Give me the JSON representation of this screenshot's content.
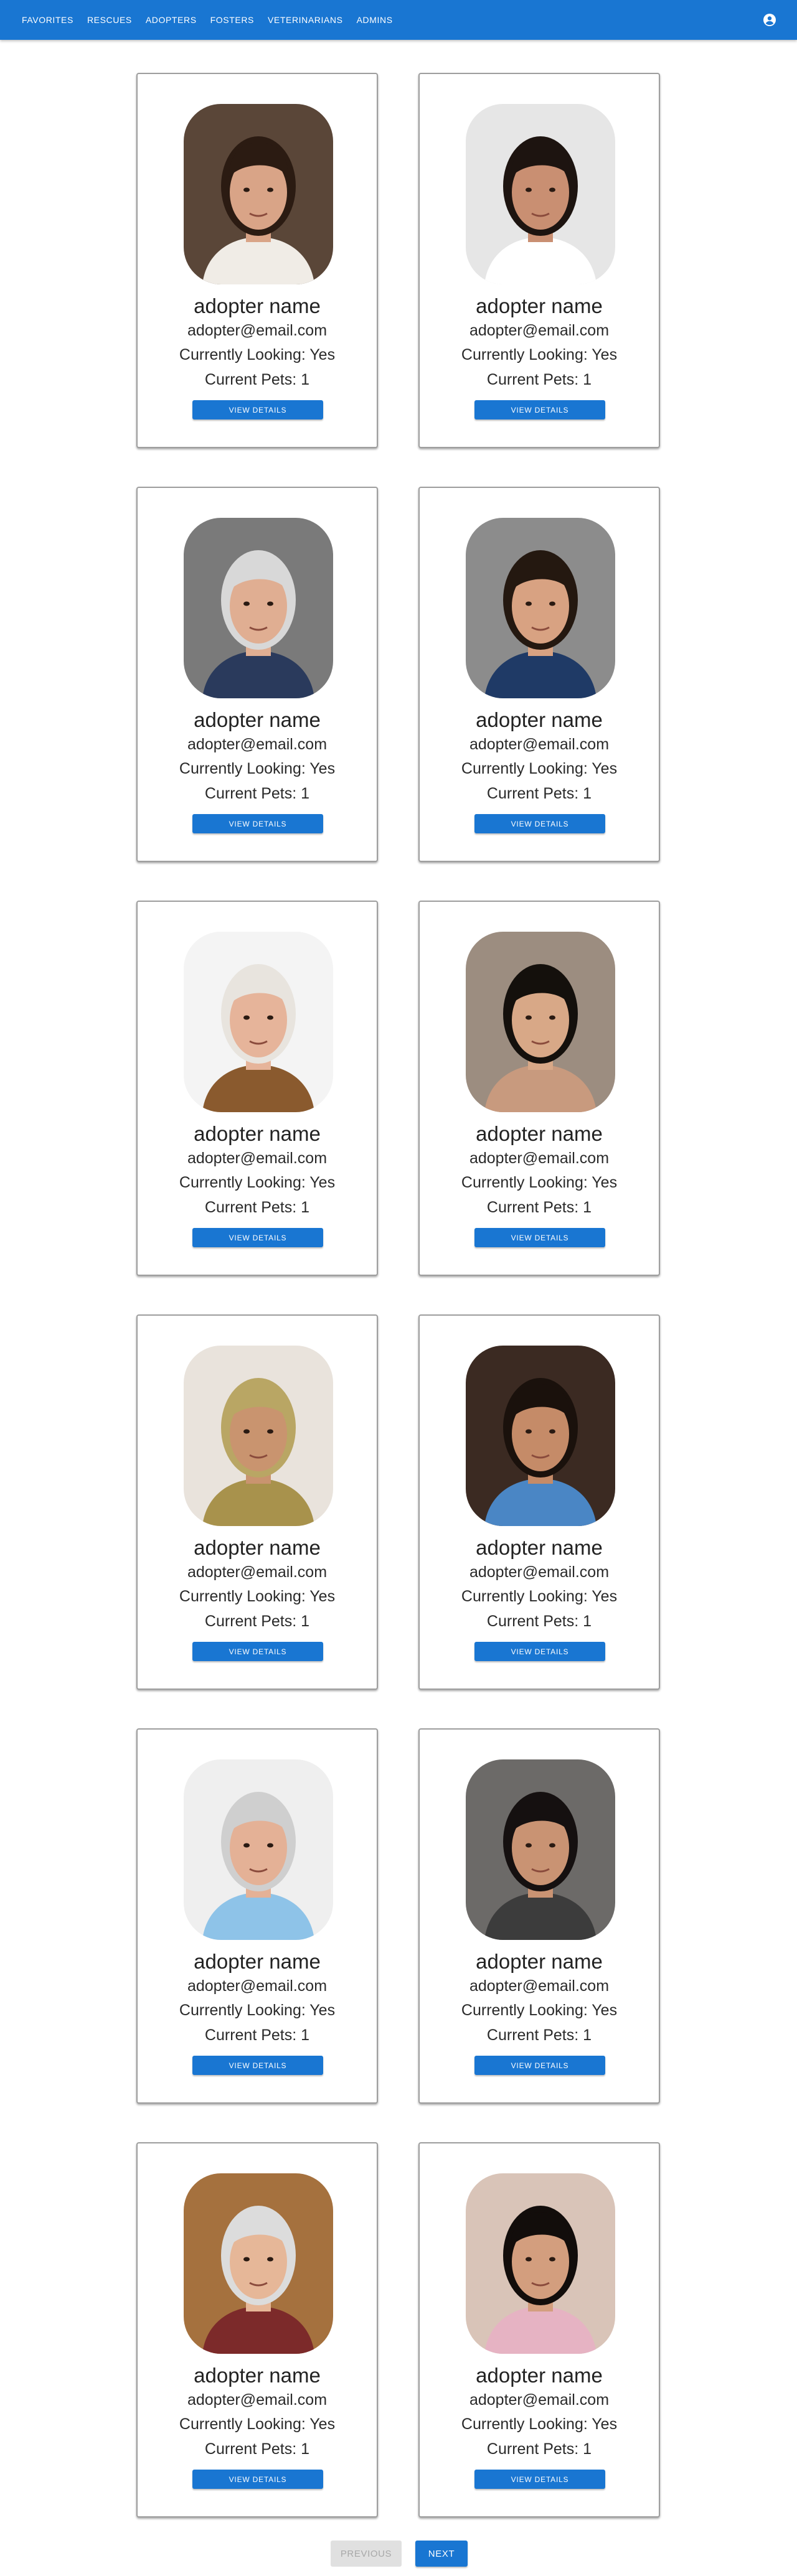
{
  "nav": {
    "items": [
      {
        "label": "Favorites"
      },
      {
        "label": "Rescues"
      },
      {
        "label": "Adopters"
      },
      {
        "label": "Fosters"
      },
      {
        "label": "Veterinarians"
      },
      {
        "label": "Admins"
      }
    ],
    "account_icon": "account-circle-icon"
  },
  "adopters": [
    {
      "name": "adopter name",
      "email": "adopter@email.com",
      "looking": "Currently Looking: Yes",
      "pets": "Current Pets: 1",
      "button": "View Details",
      "photo": {
        "bg": "#5a4638",
        "skin": "#d9a487",
        "hair": "#2b1b12",
        "shirt": "#f0ece6"
      }
    },
    {
      "name": "adopter name",
      "email": "adopter@email.com",
      "looking": "Currently Looking: Yes",
      "pets": "Current Pets: 1",
      "button": "View Details",
      "photo": {
        "bg": "#e6e6e6",
        "skin": "#c98f72",
        "hair": "#1d1410",
        "shirt": "#ffffff"
      }
    },
    {
      "name": "adopter name",
      "email": "adopter@email.com",
      "looking": "Currently Looking: Yes",
      "pets": "Current Pets: 1",
      "button": "View Details",
      "photo": {
        "bg": "#7a7a7a",
        "skin": "#e0ae92",
        "hair": "#d8d8d8",
        "shirt": "#2a3a5c"
      }
    },
    {
      "name": "adopter name",
      "email": "adopter@email.com",
      "looking": "Currently Looking: Yes",
      "pets": "Current Pets: 1",
      "button": "View Details",
      "photo": {
        "bg": "#8c8c8c",
        "skin": "#d8a282",
        "hair": "#241810",
        "shirt": "#1f3a66"
      }
    },
    {
      "name": "adopter name",
      "email": "adopter@email.com",
      "looking": "Currently Looking: Yes",
      "pets": "Current Pets: 1",
      "button": "View Details",
      "photo": {
        "bg": "#f4f4f4",
        "skin": "#e6b49a",
        "hair": "#e8e4de",
        "shirt": "#8a5a2e"
      }
    },
    {
      "name": "adopter name",
      "email": "adopter@email.com",
      "looking": "Currently Looking: Yes",
      "pets": "Current Pets: 1",
      "button": "View Details",
      "photo": {
        "bg": "#9c8d80",
        "skin": "#d8a887",
        "hair": "#14100c",
        "shirt": "#c89a7e"
      }
    },
    {
      "name": "adopter name",
      "email": "adopter@email.com",
      "looking": "Currently Looking: Yes",
      "pets": "Current Pets: 1",
      "button": "View Details",
      "photo": {
        "bg": "#e9e3dc",
        "skin": "#c9946f",
        "hair": "#b9a664",
        "shirt": "#a8924c"
      }
    },
    {
      "name": "adopter name",
      "email": "adopter@email.com",
      "looking": "Currently Looking: Yes",
      "pets": "Current Pets: 1",
      "button": "View Details",
      "photo": {
        "bg": "#3b2a22",
        "skin": "#c58b68",
        "hair": "#1a110c",
        "shirt": "#4a86c5"
      }
    },
    {
      "name": "adopter name",
      "email": "adopter@email.com",
      "looking": "Currently Looking: Yes",
      "pets": "Current Pets: 1",
      "button": "View Details",
      "photo": {
        "bg": "#efefef",
        "skin": "#e4b196",
        "hair": "#cfcfcf",
        "shirt": "#8ec3e8"
      }
    },
    {
      "name": "adopter name",
      "email": "adopter@email.com",
      "looking": "Currently Looking: Yes",
      "pets": "Current Pets: 1",
      "button": "View Details",
      "photo": {
        "bg": "#6c6a68",
        "skin": "#c99373",
        "hair": "#151010",
        "shirt": "#3c3c3c"
      }
    },
    {
      "name": "adopter name",
      "email": "adopter@email.com",
      "looking": "Currently Looking: Yes",
      "pets": "Current Pets: 1",
      "button": "View Details",
      "photo": {
        "bg": "#a5713e",
        "skin": "#e6b798",
        "hair": "#dcdcdc",
        "shirt": "#7c2a2a"
      }
    },
    {
      "name": "adopter name",
      "email": "adopter@email.com",
      "looking": "Currently Looking: Yes",
      "pets": "Current Pets: 1",
      "button": "View Details",
      "photo": {
        "bg": "#d9c4b8",
        "skin": "#d39e7e",
        "hair": "#120d0b",
        "shirt": "#e6b3c3"
      }
    }
  ],
  "pagination": {
    "previous_label": "Previous",
    "next_label": "Next"
  },
  "colors": {
    "primary": "#1976d2",
    "disabled_bg": "#e0e0e0",
    "disabled_text": "#a8a8a8"
  }
}
